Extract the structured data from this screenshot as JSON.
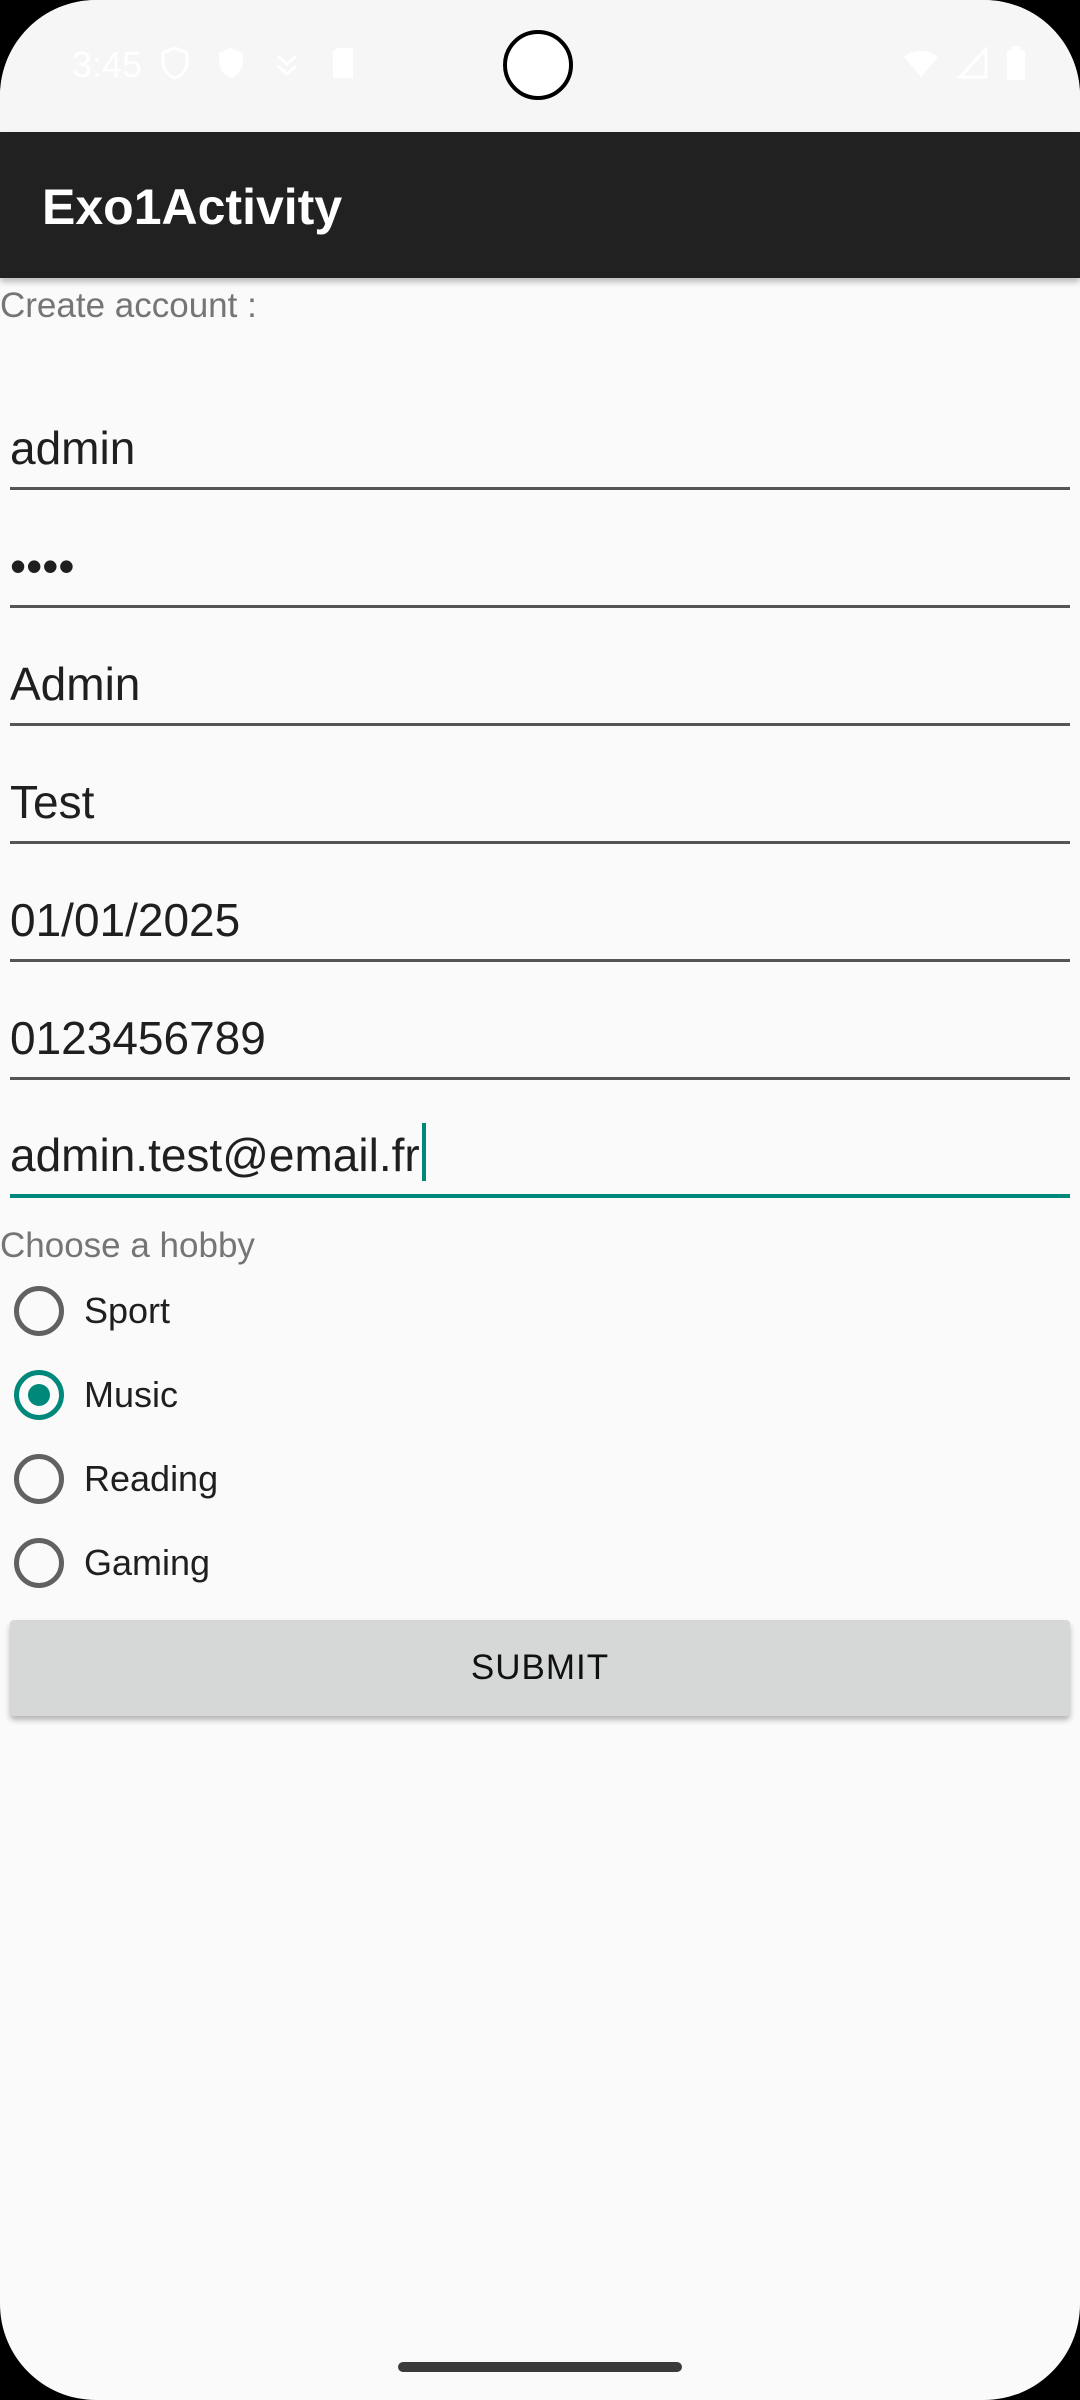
{
  "status_bar": {
    "time": "3:45",
    "left_icons": [
      "shield-outline-icon",
      "shield-icon",
      "accessibility-icon",
      "sim-card-icon"
    ],
    "right_icons": [
      "wifi-icon",
      "signal-icon",
      "battery-icon"
    ]
  },
  "app_bar": {
    "title": "Exo1Activity"
  },
  "form": {
    "header": "Create account :",
    "fields": [
      {
        "value": "admin"
      },
      {
        "value": "••••"
      },
      {
        "value": "Admin"
      },
      {
        "value": "Test"
      },
      {
        "value": "01/01/2025"
      },
      {
        "value": "0123456789"
      },
      {
        "value": "admin.test@email.fr"
      }
    ],
    "hobby_label": "Choose a hobby",
    "hobbies": [
      {
        "label": "Sport",
        "selected": false
      },
      {
        "label": "Music",
        "selected": true
      },
      {
        "label": "Reading",
        "selected": false
      },
      {
        "label": "Gaming",
        "selected": false
      }
    ],
    "submit_label": "SUBMIT"
  },
  "colors": {
    "accent": "#00897b",
    "app_bar": "#212121",
    "background": "#fafafa",
    "button": "#d6d7d7"
  }
}
